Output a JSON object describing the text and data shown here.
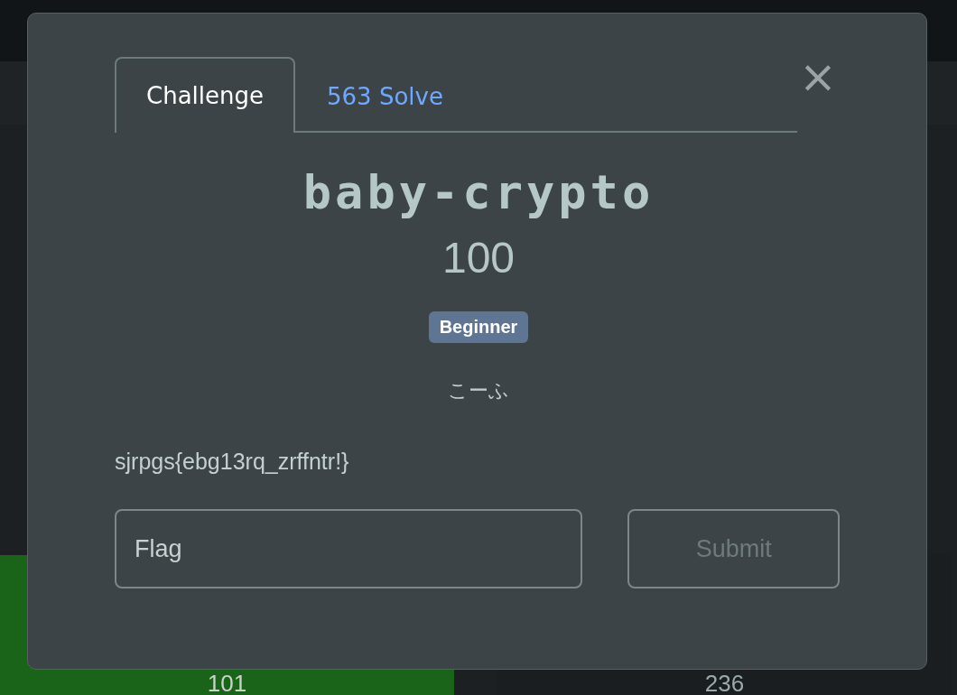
{
  "background": {
    "cells": [
      {
        "value": "101",
        "solved": true
      },
      {
        "value": "236",
        "solved": false
      }
    ]
  },
  "modal": {
    "tabs": [
      {
        "label": "Challenge",
        "selected": true
      },
      {
        "label": "563 Solve",
        "selected": false
      }
    ],
    "close": "×",
    "title": "baby-crypto",
    "points": "100",
    "tags": [
      {
        "label": "Beginner"
      }
    ],
    "author": "こーふ",
    "description": "sjrpgs{ebg13rq_zrffntr!}",
    "flag_field": {
      "placeholder": "Flag"
    },
    "submit": {
      "label": "Submit",
      "disabled": true
    }
  }
}
